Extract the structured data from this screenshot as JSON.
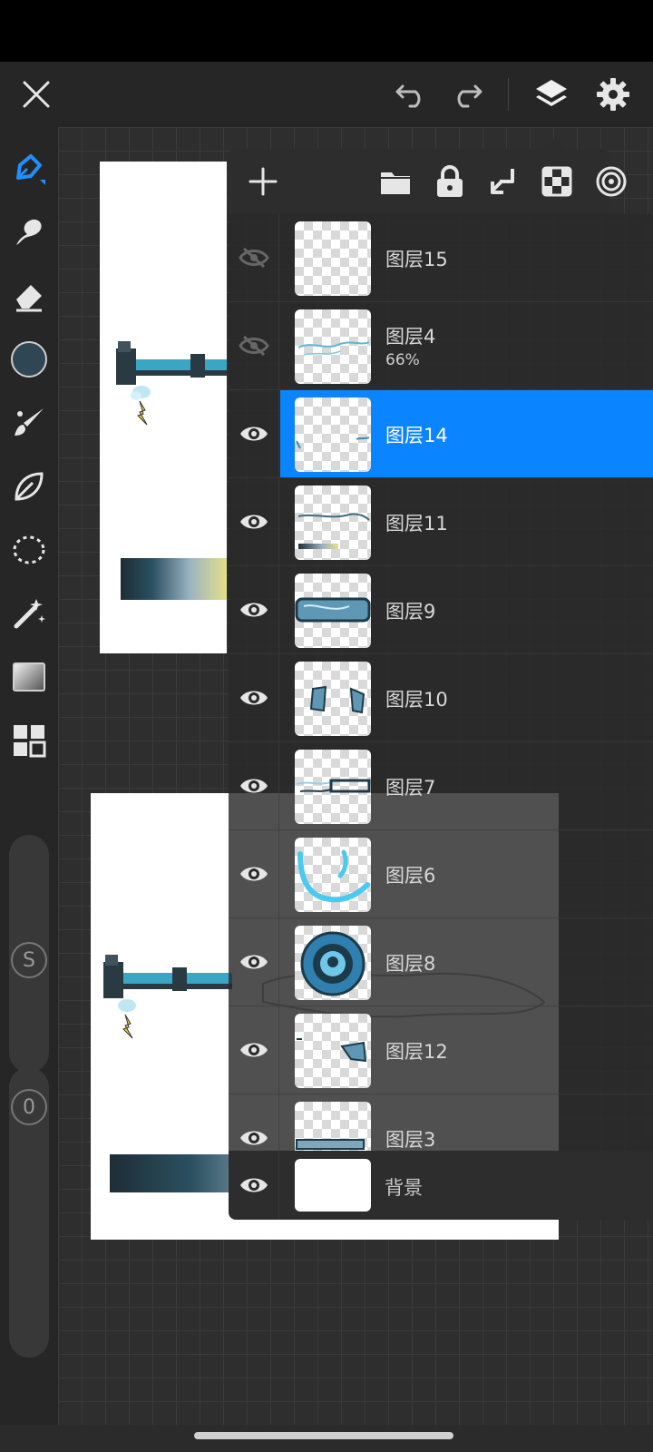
{
  "layers_panel": {
    "layers": [
      {
        "name": "图层15",
        "opacity": "",
        "visible": false,
        "selected": false
      },
      {
        "name": "图层4",
        "opacity": "66%",
        "visible": false,
        "selected": false
      },
      {
        "name": "图层14",
        "opacity": "",
        "visible": true,
        "selected": true
      },
      {
        "name": "图层11",
        "opacity": "",
        "visible": true,
        "selected": false
      },
      {
        "name": "图层9",
        "opacity": "",
        "visible": true,
        "selected": false
      },
      {
        "name": "图层10",
        "opacity": "",
        "visible": true,
        "selected": false
      },
      {
        "name": "图层7",
        "opacity": "",
        "visible": true,
        "selected": false
      },
      {
        "name": "图层6",
        "opacity": "",
        "visible": true,
        "selected": false
      },
      {
        "name": "图层8",
        "opacity": "",
        "visible": true,
        "selected": false
      },
      {
        "name": "图层12",
        "opacity": "",
        "visible": true,
        "selected": false
      },
      {
        "name": "图层3",
        "opacity": "",
        "visible": true,
        "selected": false
      }
    ],
    "background_layer": {
      "name": "背景",
      "visible": true
    }
  },
  "tool_rail": {
    "size_badge": "S",
    "opacity_badge": "0",
    "current_color": "#2f4755"
  },
  "colors": {
    "accent": "#0a84ff",
    "panel": "#2d2d2d",
    "toolbar": "#262626"
  }
}
